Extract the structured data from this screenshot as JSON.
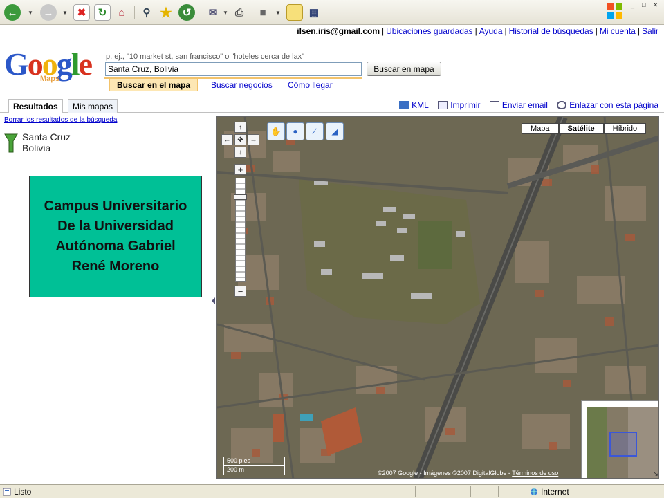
{
  "user": {
    "email": "ilsen.iris@gmail.com",
    "links": [
      "Ubicaciones guardadas",
      "Ayuda",
      "Historial de búsquedas",
      "Mi cuenta",
      "Salir"
    ]
  },
  "logo": {
    "text": "Google",
    "sub": "Maps"
  },
  "search": {
    "hint": "p. ej., \"10 market st, san francisco\" o \"hoteles cerca de lax\"",
    "value": "Santa Cruz, Bolivia",
    "button": "Buscar en mapa",
    "tabs": [
      "Buscar en el mapa",
      "Buscar negocios",
      "Cómo llegar"
    ]
  },
  "panel_tabs": [
    "Resultados",
    "Mis mapas"
  ],
  "actions": [
    "KML",
    "Imprimir",
    "Enviar email",
    "Enlazar con esta página"
  ],
  "results": {
    "clear": "Borrar los resultados de la búsqueda",
    "place_line1": "Santa Cruz",
    "place_line2": "Bolivia"
  },
  "callout": {
    "line1": "Campus Universitario",
    "line2": "De la Universidad",
    "line3": "Autónoma Gabriel",
    "line4": "René Moreno"
  },
  "map": {
    "types": [
      "Mapa",
      "Satélite",
      "Híbrido"
    ],
    "active_type": "Satélite",
    "scale_ft": "500 pies",
    "scale_m": "200 m",
    "copyright": "©2007 Google - Imágenes ©2007 DigitalGlobe - ",
    "terms": "Términos de uso"
  },
  "status": {
    "text": "Listo",
    "zone": "Internet"
  }
}
